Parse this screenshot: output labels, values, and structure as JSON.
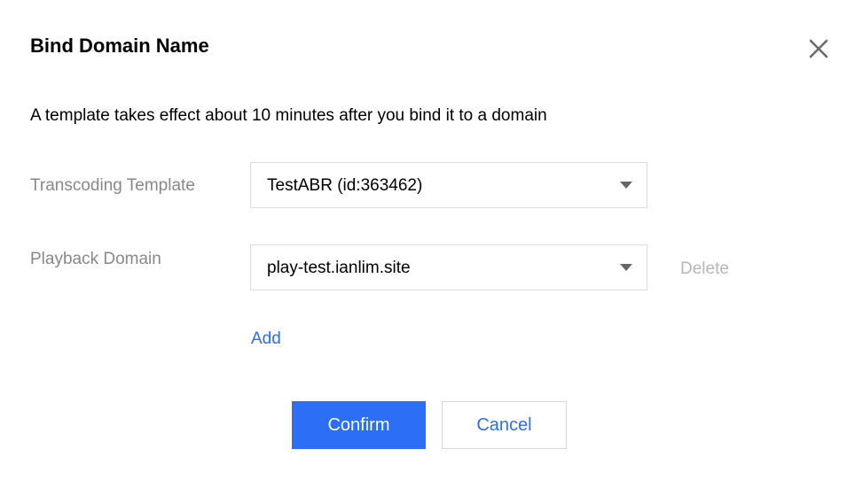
{
  "dialog": {
    "title": "Bind Domain Name",
    "description": "A template takes effect about 10 minutes after you bind it to a domain",
    "close_icon": "close-icon",
    "template": {
      "label": "Transcoding Template",
      "value": "TestABR (id:363462)"
    },
    "domain": {
      "label": "Playback Domain",
      "value": "play-test.ianlim.site",
      "delete_label": "Delete"
    },
    "add_label": "Add",
    "confirm_label": "Confirm",
    "cancel_label": "Cancel"
  },
  "colors": {
    "primary": "#2c6ef5",
    "link": "#2a6ff0",
    "label_gray": "#888888",
    "disabled_gray": "#b6b6b6"
  }
}
